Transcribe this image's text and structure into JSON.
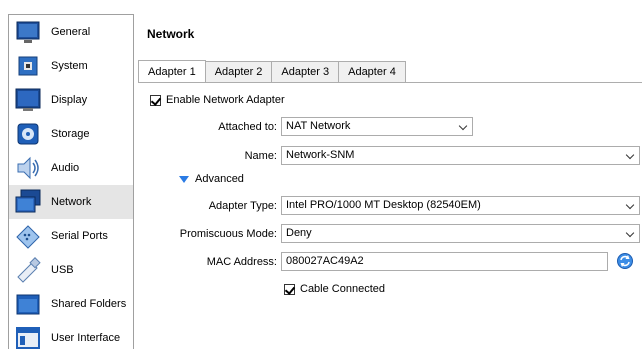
{
  "sidebar": {
    "items": [
      {
        "label": "General",
        "icon": "general-icon"
      },
      {
        "label": "System",
        "icon": "system-icon"
      },
      {
        "label": "Display",
        "icon": "display-icon"
      },
      {
        "label": "Storage",
        "icon": "storage-icon"
      },
      {
        "label": "Audio",
        "icon": "audio-icon"
      },
      {
        "label": "Network",
        "icon": "network-icon"
      },
      {
        "label": "Serial Ports",
        "icon": "serial-ports-icon"
      },
      {
        "label": "USB",
        "icon": "usb-icon"
      },
      {
        "label": "Shared Folders",
        "icon": "shared-folders-icon"
      },
      {
        "label": "User Interface",
        "icon": "user-interface-icon"
      }
    ],
    "selected": "Network"
  },
  "main": {
    "title": "Network",
    "tabs": [
      "Adapter 1",
      "Adapter 2",
      "Adapter 3",
      "Adapter 4"
    ],
    "active_tab": "Adapter 1",
    "enable_adapter_label": "Enable Network Adapter",
    "enable_adapter_checked": true,
    "attached_to_label": "Attached to:",
    "attached_to_value": "NAT Network",
    "name_label": "Name:",
    "name_value": "Network-SNM",
    "advanced_label": "Advanced",
    "adapter_type_label": "Adapter Type:",
    "adapter_type_value": "Intel PRO/1000 MT Desktop (82540EM)",
    "promiscuous_label": "Promiscuous Mode:",
    "promiscuous_value": "Deny",
    "mac_label": "MAC Address:",
    "mac_value": "080027AC49A2",
    "cable_label": "Cable Connected",
    "cable_checked": true
  },
  "colors": {
    "selected_bg": "#e5e5e5",
    "accent_blue": "#2a7be4",
    "border": "#acacac"
  }
}
